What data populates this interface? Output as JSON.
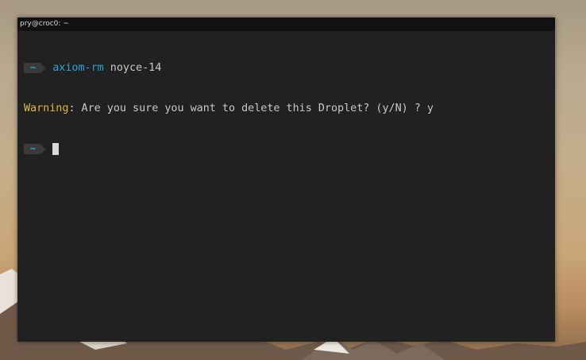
{
  "window": {
    "title": "pry@croc0: ~"
  },
  "terminal": {
    "line1": {
      "prompt_dir": "~",
      "command": "axiom-rm",
      "argument": "noyce-14"
    },
    "line2": {
      "warning_label": "Warning",
      "message": ": Are you sure you want to delete this Droplet? (y/N) ? y"
    },
    "line3": {
      "prompt_dir": "~"
    }
  },
  "colors": {
    "prompt_accent": "#2aa3d8",
    "warning": "#e0b840",
    "terminal_bg": "#212121"
  }
}
